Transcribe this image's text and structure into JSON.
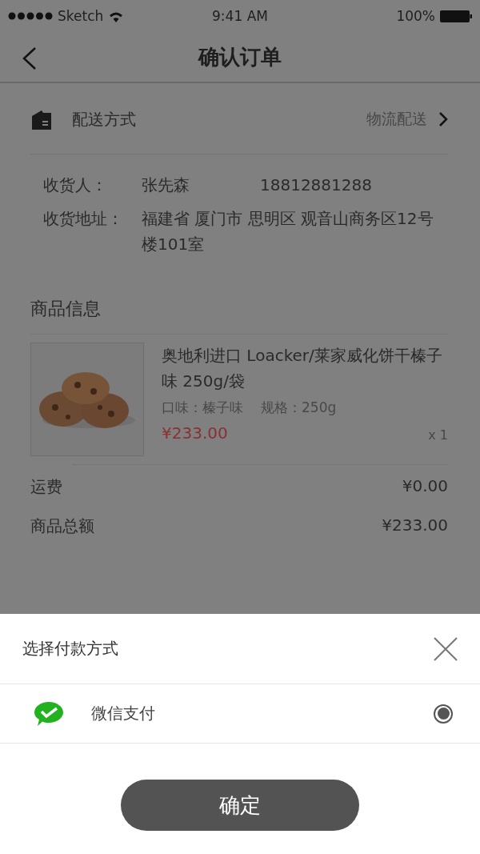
{
  "status_bar": {
    "carrier": "Sketch",
    "time": "9:41 AM",
    "battery": "100%"
  },
  "nav": {
    "title": "确认订单"
  },
  "delivery": {
    "label": "配送方式",
    "value": "物流配送"
  },
  "recipient": {
    "name_label": "收货人：",
    "name": "张先森",
    "phone": "18812881288",
    "address_label": "收货地址：",
    "address": "福建省 厦门市 思明区 观音山商务区12号楼101室"
  },
  "goods": {
    "title": "商品信息",
    "items": [
      {
        "name": "奥地利进口 Loacker/莱家威化饼干榛子味 250g/袋",
        "options": [
          "口味：榛子味",
          "规格：250g"
        ],
        "price": "¥233.00",
        "quantity": "x 1"
      }
    ]
  },
  "summary": [
    {
      "label": "运费",
      "value": "¥0.00"
    },
    {
      "label": "商品总额",
      "value": "¥233.00"
    }
  ],
  "payment_sheet": {
    "title": "选择付款方式",
    "methods": [
      {
        "name": "微信支付",
        "selected": true
      }
    ],
    "confirm": "确定"
  }
}
